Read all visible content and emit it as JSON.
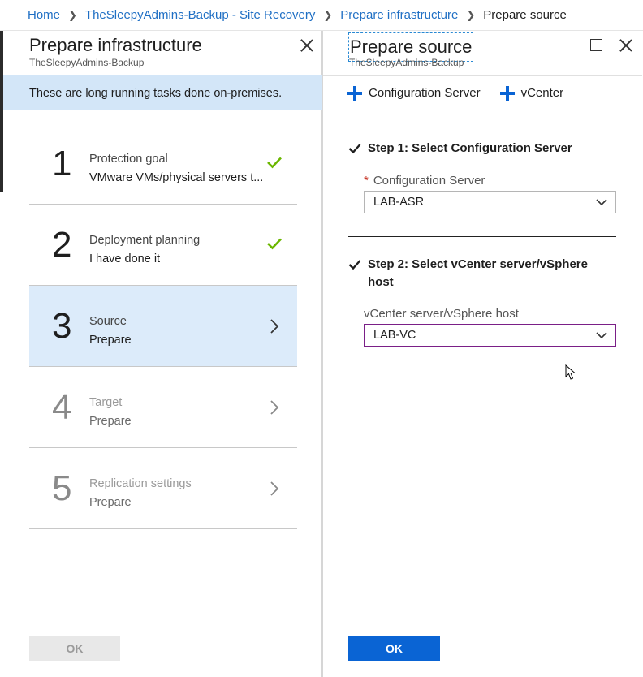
{
  "breadcrumb": {
    "items": [
      "Home",
      "TheSleepyAdmins-Backup - Site Recovery",
      "Prepare infrastructure"
    ],
    "current": "Prepare source"
  },
  "left_blade": {
    "title": "Prepare infrastructure",
    "subtitle": "TheSleepyAdmins-Backup",
    "info": "These are long running tasks done on-premises.",
    "steps": [
      {
        "number": "1",
        "title": "Protection goal",
        "subtitle": "VMware VMs/physical servers t...",
        "status": "check-icon"
      },
      {
        "number": "2",
        "title": "Deployment planning",
        "subtitle": "I have done it",
        "status": "check-icon"
      },
      {
        "number": "3",
        "title": "Source",
        "subtitle": "Prepare",
        "status": "chevron-right-icon"
      },
      {
        "number": "4",
        "title": "Target",
        "subtitle": "Prepare",
        "status": "chevron-right-icon"
      },
      {
        "number": "5",
        "title": "Replication settings",
        "subtitle": "Prepare",
        "status": "chevron-right-icon"
      }
    ],
    "ok_label": "OK"
  },
  "right_blade": {
    "title": "Prepare source",
    "subtitle": "TheSleepyAdmins-Backup",
    "toolbar": {
      "config_server_label": "Configuration Server",
      "vcenter_label": "vCenter"
    },
    "step1": {
      "heading": "Step 1: Select Configuration Server",
      "required_mark": "*",
      "field_label": "Configuration Server",
      "value": "LAB-ASR"
    },
    "step2": {
      "heading": "Step 2: Select vCenter server/vSphere host",
      "field_label": "vCenter server/vSphere host",
      "value": "LAB-VC"
    },
    "ok_label": "OK"
  },
  "colors": {
    "accent": "#0a64d4",
    "link": "#1f6fc4",
    "success": "#6bb700",
    "info_bg": "#d3e6f8",
    "selected_bg": "#dcebfa",
    "focus_border": "#7a1f87"
  }
}
